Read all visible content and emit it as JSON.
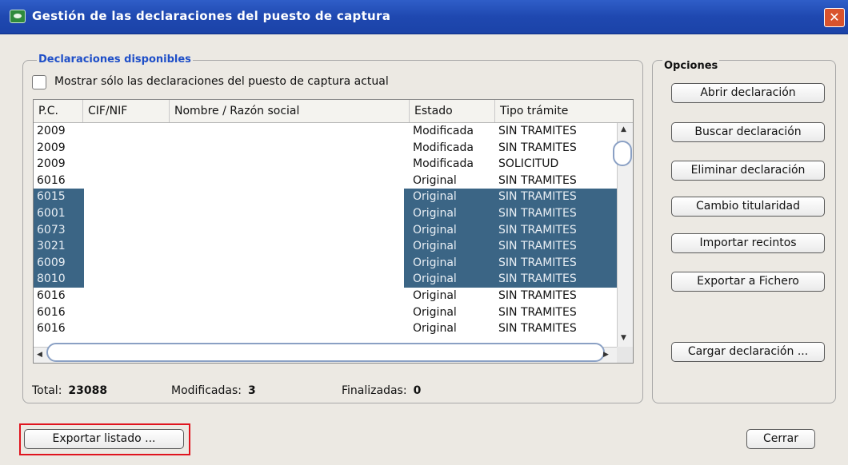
{
  "window": {
    "title": "Gestión de las declaraciones del puesto de captura",
    "close_glyph": "✕"
  },
  "declaraciones": {
    "group_title": "Declaraciones disponibles",
    "checkbox_label": "Mostrar sólo las declaraciones del puesto de captura actual",
    "checkbox_checked": false,
    "columns": [
      "P.C.",
      "CIF/NIF",
      "Nombre / Razón social",
      "Estado",
      "Tipo trámite"
    ],
    "rows": [
      {
        "pc": "2009",
        "estado": "Modificada",
        "tipo": "SIN TRAMITES",
        "selected": false
      },
      {
        "pc": "2009",
        "estado": "Modificada",
        "tipo": "SIN TRAMITES",
        "selected": false
      },
      {
        "pc": "2009",
        "estado": "Modificada",
        "tipo": "SOLICITUD",
        "selected": false
      },
      {
        "pc": "6016",
        "estado": "Original",
        "tipo": "SIN TRAMITES",
        "selected": false
      },
      {
        "pc": "6015",
        "estado": "Original",
        "tipo": "SIN TRAMITES",
        "selected": true
      },
      {
        "pc": "6001",
        "estado": "Original",
        "tipo": "SIN TRAMITES",
        "selected": true
      },
      {
        "pc": "6073",
        "estado": "Original",
        "tipo": "SIN TRAMITES",
        "selected": true
      },
      {
        "pc": "3021",
        "estado": "Original",
        "tipo": "SIN TRAMITES",
        "selected": true
      },
      {
        "pc": "6009",
        "estado": "Original",
        "tipo": "SIN TRAMITES",
        "selected": true
      },
      {
        "pc": "8010",
        "estado": "Original",
        "tipo": "SIN TRAMITES",
        "selected": true
      },
      {
        "pc": "6016",
        "estado": "Original",
        "tipo": "SIN TRAMITES",
        "selected": false
      },
      {
        "pc": "6016",
        "estado": "Original",
        "tipo": "SIN TRAMITES",
        "selected": false
      },
      {
        "pc": "6016",
        "estado": "Original",
        "tipo": "SIN TRAMITES",
        "selected": false
      }
    ],
    "selection_color": "#3b6585"
  },
  "stats": {
    "total_label": "Total:",
    "total_value": "23088",
    "modificadas_label": "Modificadas:",
    "modificadas_value": "3",
    "finalizadas_label": "Finalizadas:",
    "finalizadas_value": "0"
  },
  "opciones": {
    "group_title": "Opciones",
    "abrir": "Abrir declaración",
    "buscar": "Buscar declaración",
    "eliminar": "Eliminar declaración",
    "cambio": "Cambio titularidad",
    "importar": "Importar recintos",
    "exportar_fichero": "Exportar a Fichero",
    "cargar": "Cargar declaración ..."
  },
  "footer": {
    "exportar_listado": "Exportar listado ...",
    "cerrar": "Cerrar"
  },
  "colors": {
    "titlebar": "#1f48b0",
    "highlight": "#e0141e"
  }
}
